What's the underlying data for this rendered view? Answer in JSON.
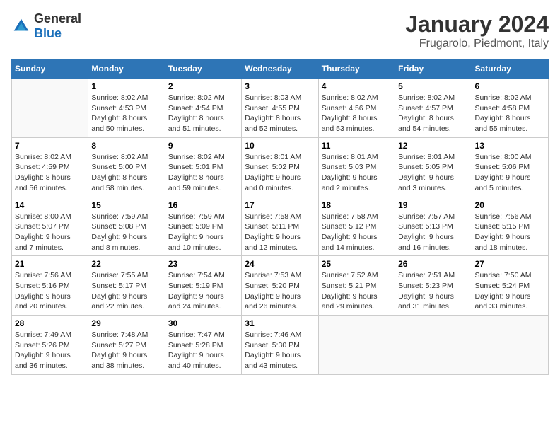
{
  "logo": {
    "general": "General",
    "blue": "Blue"
  },
  "title": "January 2024",
  "subtitle": "Frugarolo, Piedmont, Italy",
  "days_of_week": [
    "Sunday",
    "Monday",
    "Tuesday",
    "Wednesday",
    "Thursday",
    "Friday",
    "Saturday"
  ],
  "weeks": [
    [
      {
        "day": "",
        "info": ""
      },
      {
        "day": "1",
        "info": "Sunrise: 8:02 AM\nSunset: 4:53 PM\nDaylight: 8 hours\nand 50 minutes."
      },
      {
        "day": "2",
        "info": "Sunrise: 8:02 AM\nSunset: 4:54 PM\nDaylight: 8 hours\nand 51 minutes."
      },
      {
        "day": "3",
        "info": "Sunrise: 8:03 AM\nSunset: 4:55 PM\nDaylight: 8 hours\nand 52 minutes."
      },
      {
        "day": "4",
        "info": "Sunrise: 8:02 AM\nSunset: 4:56 PM\nDaylight: 8 hours\nand 53 minutes."
      },
      {
        "day": "5",
        "info": "Sunrise: 8:02 AM\nSunset: 4:57 PM\nDaylight: 8 hours\nand 54 minutes."
      },
      {
        "day": "6",
        "info": "Sunrise: 8:02 AM\nSunset: 4:58 PM\nDaylight: 8 hours\nand 55 minutes."
      }
    ],
    [
      {
        "day": "7",
        "info": "Sunrise: 8:02 AM\nSunset: 4:59 PM\nDaylight: 8 hours\nand 56 minutes."
      },
      {
        "day": "8",
        "info": "Sunrise: 8:02 AM\nSunset: 5:00 PM\nDaylight: 8 hours\nand 58 minutes."
      },
      {
        "day": "9",
        "info": "Sunrise: 8:02 AM\nSunset: 5:01 PM\nDaylight: 8 hours\nand 59 minutes."
      },
      {
        "day": "10",
        "info": "Sunrise: 8:01 AM\nSunset: 5:02 PM\nDaylight: 9 hours\nand 0 minutes."
      },
      {
        "day": "11",
        "info": "Sunrise: 8:01 AM\nSunset: 5:03 PM\nDaylight: 9 hours\nand 2 minutes."
      },
      {
        "day": "12",
        "info": "Sunrise: 8:01 AM\nSunset: 5:05 PM\nDaylight: 9 hours\nand 3 minutes."
      },
      {
        "day": "13",
        "info": "Sunrise: 8:00 AM\nSunset: 5:06 PM\nDaylight: 9 hours\nand 5 minutes."
      }
    ],
    [
      {
        "day": "14",
        "info": "Sunrise: 8:00 AM\nSunset: 5:07 PM\nDaylight: 9 hours\nand 7 minutes."
      },
      {
        "day": "15",
        "info": "Sunrise: 7:59 AM\nSunset: 5:08 PM\nDaylight: 9 hours\nand 8 minutes."
      },
      {
        "day": "16",
        "info": "Sunrise: 7:59 AM\nSunset: 5:09 PM\nDaylight: 9 hours\nand 10 minutes."
      },
      {
        "day": "17",
        "info": "Sunrise: 7:58 AM\nSunset: 5:11 PM\nDaylight: 9 hours\nand 12 minutes."
      },
      {
        "day": "18",
        "info": "Sunrise: 7:58 AM\nSunset: 5:12 PM\nDaylight: 9 hours\nand 14 minutes."
      },
      {
        "day": "19",
        "info": "Sunrise: 7:57 AM\nSunset: 5:13 PM\nDaylight: 9 hours\nand 16 minutes."
      },
      {
        "day": "20",
        "info": "Sunrise: 7:56 AM\nSunset: 5:15 PM\nDaylight: 9 hours\nand 18 minutes."
      }
    ],
    [
      {
        "day": "21",
        "info": "Sunrise: 7:56 AM\nSunset: 5:16 PM\nDaylight: 9 hours\nand 20 minutes."
      },
      {
        "day": "22",
        "info": "Sunrise: 7:55 AM\nSunset: 5:17 PM\nDaylight: 9 hours\nand 22 minutes."
      },
      {
        "day": "23",
        "info": "Sunrise: 7:54 AM\nSunset: 5:19 PM\nDaylight: 9 hours\nand 24 minutes."
      },
      {
        "day": "24",
        "info": "Sunrise: 7:53 AM\nSunset: 5:20 PM\nDaylight: 9 hours\nand 26 minutes."
      },
      {
        "day": "25",
        "info": "Sunrise: 7:52 AM\nSunset: 5:21 PM\nDaylight: 9 hours\nand 29 minutes."
      },
      {
        "day": "26",
        "info": "Sunrise: 7:51 AM\nSunset: 5:23 PM\nDaylight: 9 hours\nand 31 minutes."
      },
      {
        "day": "27",
        "info": "Sunrise: 7:50 AM\nSunset: 5:24 PM\nDaylight: 9 hours\nand 33 minutes."
      }
    ],
    [
      {
        "day": "28",
        "info": "Sunrise: 7:49 AM\nSunset: 5:26 PM\nDaylight: 9 hours\nand 36 minutes."
      },
      {
        "day": "29",
        "info": "Sunrise: 7:48 AM\nSunset: 5:27 PM\nDaylight: 9 hours\nand 38 minutes."
      },
      {
        "day": "30",
        "info": "Sunrise: 7:47 AM\nSunset: 5:28 PM\nDaylight: 9 hours\nand 40 minutes."
      },
      {
        "day": "31",
        "info": "Sunrise: 7:46 AM\nSunset: 5:30 PM\nDaylight: 9 hours\nand 43 minutes."
      },
      {
        "day": "",
        "info": ""
      },
      {
        "day": "",
        "info": ""
      },
      {
        "day": "",
        "info": ""
      }
    ]
  ]
}
